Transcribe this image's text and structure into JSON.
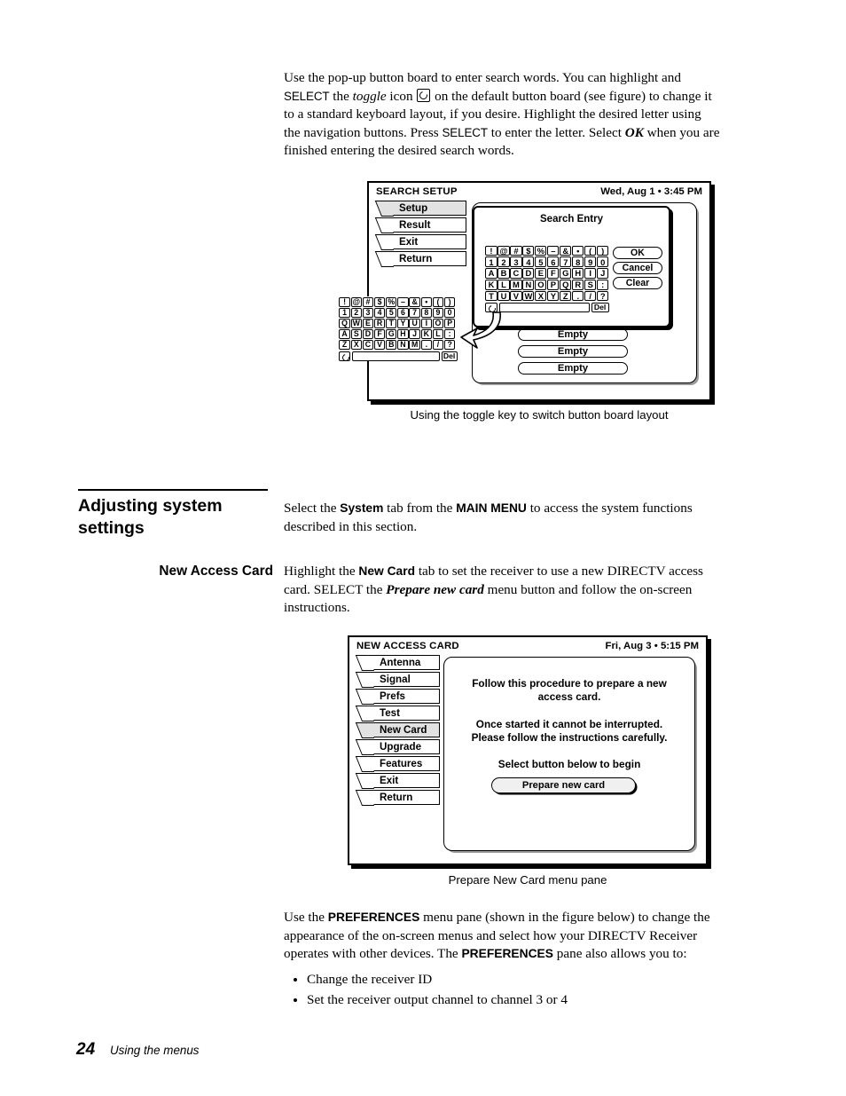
{
  "intro_paragraph": {
    "line1_a": "Use the pop-up button board to enter search words. You can highlight and",
    "select_1": "SELECT",
    "line2_a": " the ",
    "toggle_word": "toggle",
    "line2_b": " icon ",
    "line2_c": " on the default button board (see figure) to change it",
    "line3": "to a standard keyboard layout, if you desire. Highlight the desired letter using",
    "line4_a": "the navigation buttons. Press ",
    "select_2": "SELECT",
    "line4_b": " to enter the letter. Select ",
    "ok_word": "OK",
    "line4_c": " when you are",
    "line5": "finished entering the desired search words."
  },
  "figure1": {
    "caption": "Using the toggle key to switch button board layout",
    "screen_title": "SEARCH SETUP",
    "clock": "Wed, Aug 1  •  3:45 PM",
    "tabs": [
      {
        "label": "Setup",
        "selected": true
      },
      {
        "label": "Result",
        "selected": false
      },
      {
        "label": "Exit",
        "selected": false
      },
      {
        "label": "Return",
        "selected": false
      }
    ],
    "popup": {
      "title": "Search Entry",
      "keyboard_rows": [
        [
          "!",
          "@",
          "#",
          "$",
          "%",
          "–",
          "&",
          "•",
          "(",
          ")"
        ],
        [
          "1",
          "2",
          "3",
          "4",
          "5",
          "6",
          "7",
          "8",
          "9",
          "0"
        ],
        [
          "A",
          "B",
          "C",
          "D",
          "E",
          "F",
          "G",
          "H",
          "I",
          "J"
        ],
        [
          "K",
          "L",
          "M",
          "N",
          "O",
          "P",
          "Q",
          "R",
          "S",
          ":"
        ],
        [
          "T",
          "U",
          "V",
          "W",
          "X",
          "Y",
          "Z",
          ".",
          "/",
          "?"
        ]
      ],
      "toggle_icon": "toggle-icon",
      "entry_value": "",
      "del_label": "Del",
      "buttons": [
        "OK",
        "Cancel",
        "Clear"
      ]
    },
    "alt_keyboard": {
      "rows": [
        [
          "!",
          "@",
          "#",
          "$",
          "%",
          "–",
          "&",
          "•",
          "(",
          ")"
        ],
        [
          "1",
          "2",
          "3",
          "4",
          "5",
          "6",
          "7",
          "8",
          "9",
          "0"
        ],
        [
          "Q",
          "W",
          "E",
          "R",
          "T",
          "Y",
          "U",
          "I",
          "O",
          "P"
        ],
        [
          "A",
          "S",
          "D",
          "F",
          "G",
          "H",
          "J",
          "K",
          "L",
          ":"
        ],
        [
          "Z",
          "X",
          "C",
          "V",
          "B",
          "N",
          "M",
          ".",
          "/",
          "?"
        ]
      ],
      "toggle_icon": "toggle-icon",
      "entry_value": "",
      "del_label": "Del"
    },
    "list_buttons": [
      "Empty",
      "Empty",
      "Empty"
    ]
  },
  "section": {
    "heading_line1": "Adjusting system",
    "heading_line2": "settings",
    "intro_a": "Select the ",
    "intro_system": "System",
    "intro_b": " tab from the ",
    "intro_mainmenu": "MAIN MENU",
    "intro_c": " to access the system functions",
    "intro_d": "described in this section."
  },
  "subsection": {
    "sidehead": "New Access Card",
    "para_a": "Highlight the ",
    "para_newcard": "New Card",
    "para_b": " tab to set the receiver to use a new DIRECTV access",
    "para_c": "card. SELECT the ",
    "para_prepare": "Prepare new card",
    "para_d": " menu button and follow the on-screen",
    "para_e": "instructions."
  },
  "figure2": {
    "caption": "Prepare New Card menu pane",
    "screen_title": "NEW ACCESS CARD",
    "clock": "Fri, Aug 3  •  5:15 PM",
    "tabs": [
      {
        "label": "Antenna",
        "selected": false
      },
      {
        "label": "Signal",
        "selected": false
      },
      {
        "label": "Prefs",
        "selected": false
      },
      {
        "label": "Test",
        "selected": false
      },
      {
        "label": "New Card",
        "selected": true
      },
      {
        "label": "Upgrade",
        "selected": false
      },
      {
        "label": "Features",
        "selected": false
      },
      {
        "label": "Exit",
        "selected": false
      },
      {
        "label": "Return",
        "selected": false
      }
    ],
    "message_block1_line1": "Follow this procedure to prepare a new",
    "message_block1_line2": "access card.",
    "message_block2_line1": "Once started it cannot be interrupted.",
    "message_block2_line2": "Please follow the instructions carefully.",
    "message_block3": "Select button below to begin",
    "action_button": "Prepare new card"
  },
  "closing_paragraph": {
    "line1_a": "Use the ",
    "pref_1": "PREFERENCES",
    "line1_b": " menu pane (shown in the figure below) to change the",
    "line2": "appearance of the on-screen menus and select how your DIRECTV Receiver",
    "line3_a": "operates with other devices. The ",
    "pref_2": "PREFERENCES",
    "line3_b": " pane also allows you to:",
    "bullets": [
      "Change the receiver ID",
      "Set the receiver output channel to channel 3 or 4"
    ]
  },
  "footer": {
    "page_number": "24",
    "running_head": "Using the menus"
  }
}
